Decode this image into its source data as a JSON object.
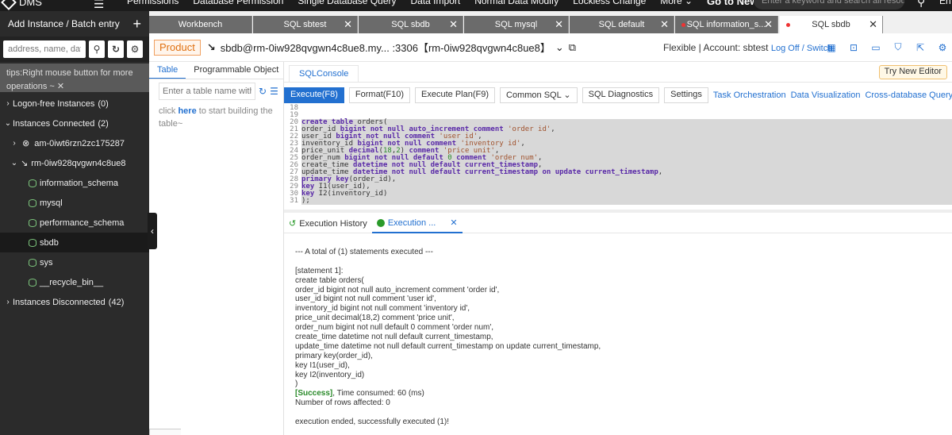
{
  "topbar": {
    "app_name": "DMS",
    "menu": [
      "Permissions",
      "Database Permission",
      "Single Database Query",
      "Data Import",
      "Normal Data Modify",
      "Lockless Change",
      "More"
    ],
    "highlight": "Go to New version",
    "search_placeholder": "Enter a keyword and search all resources",
    "lang": "En"
  },
  "sidebar": {
    "add_label": "Add Instance / Batch entry",
    "search_placeholder": "address, name, databa",
    "tips": "tips:Right mouse button for more operations ~",
    "tree": {
      "logon_free": {
        "label": "Logon-free Instances",
        "count": "(0)"
      },
      "connected": {
        "label": "Instances Connected",
        "count": "(2)"
      },
      "inst1": "am-0iwt6rzn2zc175287",
      "inst2": "rm-0iw928qvgwn4c8ue8",
      "dbs": [
        "information_schema",
        "mysql",
        "performance_schema",
        "sbdb",
        "sys",
        "__recycle_bin__"
      ],
      "disconnected": {
        "label": "Instances Disconnected",
        "count": "(42)"
      }
    }
  },
  "tabs": {
    "workbench": "Workbench",
    "sbtest": "SQL sbtest",
    "sbdb1": "SQL sbdb",
    "mysql": "SQL mysql",
    "default": "SQL default",
    "info": "SQL information_s...",
    "sbdb_active": "SQL sbdb"
  },
  "header": {
    "product": "Product",
    "connection": "sbdb@rm-0iw928qvgwn4c8ue8.my... :3306【rm-0iw928qvgwn4c8ue8】",
    "mode": "Flexible | Account: sbtest",
    "logoff": "Log Off / Switch"
  },
  "objpanel": {
    "tab_table": "Table",
    "tab_prog": "Programmable Object",
    "placeholder": "Enter a table name with % !",
    "hint_pre": "click",
    "hint_here": "here",
    "hint_post": "to start building the table~"
  },
  "main": {
    "console_tab": "SQLConsole",
    "new_editor": "Try New Editor",
    "buttons": {
      "execute": "Execute(F8)",
      "format": "Format(F10)",
      "plan": "Execute Plan(F9)",
      "common": "Common SQL",
      "diag": "SQL Diagnostics",
      "settings": "Settings"
    },
    "links": {
      "task": "Task Orchestration",
      "viz": "Data Visualization",
      "cross": "Cross-database Query"
    },
    "result_tabs": {
      "history": "Execution History",
      "exec": "Execution ..."
    }
  },
  "result": {
    "summary": "--- A total of (1) statements executed ---",
    "statement": "[statement 1]:",
    "sql_lines": [
      "create table orders(",
      "order_id bigint not null auto_increment comment 'order id',",
      "user_id bigint not null comment 'user id',",
      "inventory_id bigint not null comment 'inventory id',",
      "price_unit decimal(18,2) comment 'price unit',",
      "order_num bigint not null default 0 comment 'order num',",
      "create_time datetime not null default current_timestamp,",
      "update_time datetime not null default current_timestamp on update current_timestamp,",
      "primary key(order_id),",
      "key I1(user_id),",
      "key I2(inventory_id)",
      ")"
    ],
    "success": "[Success]",
    "time": ", Time consumed: 60 (ms)",
    "rows": "Number of rows affected: 0",
    "ended": "execution ended, successfully executed (1)!"
  }
}
